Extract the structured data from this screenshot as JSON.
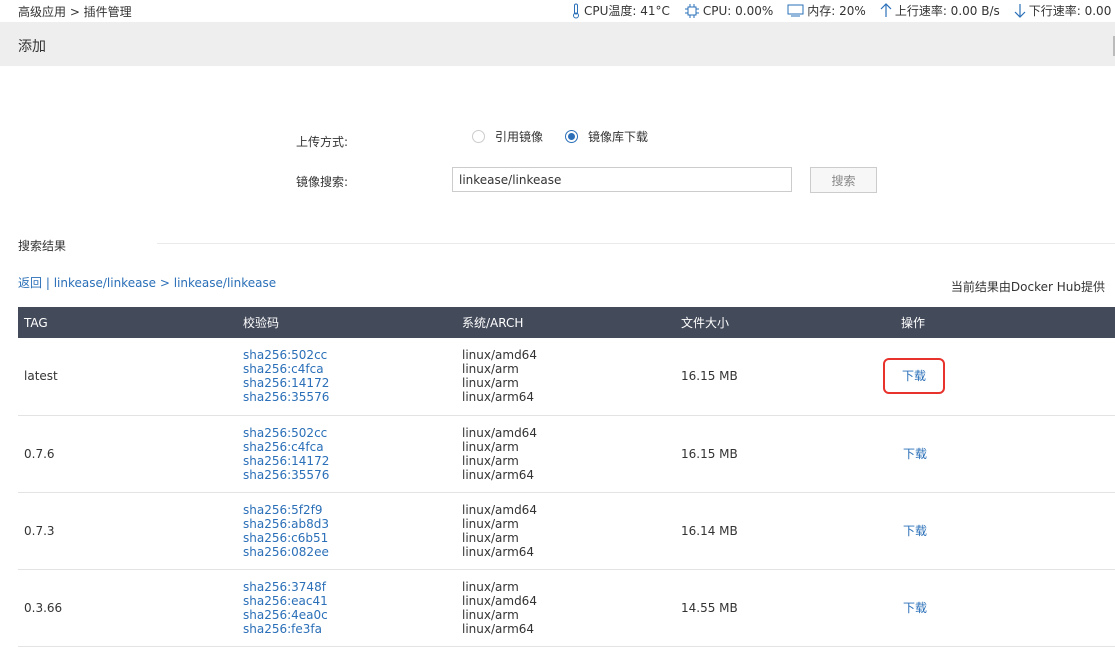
{
  "breadcrumb": "高级应用 > 插件管理",
  "status": {
    "cpu_temp": "CPU温度: 41°C",
    "cpu": "CPU: 0.00%",
    "memory": "内存: 20%",
    "upload": "上行速率: 0.00 B/s",
    "download": "下行速率: 0.00 B"
  },
  "header": {
    "title": "添加"
  },
  "form": {
    "upload_label": "上传方式:",
    "radio_ref": "引用镜像",
    "radio_repo": "镜像库下载",
    "selected": "镜像库下载",
    "search_label": "镜像搜索:",
    "search_value": "linkease/linkease",
    "search_button": "搜索"
  },
  "results": {
    "title": "搜索结果",
    "crumbs": {
      "back": "返回",
      "sep": " | ",
      "repo": "linkease/linkease",
      "arrow": " > ",
      "repo2": "linkease/linkease"
    },
    "provider": "当前结果由Docker Hub提供",
    "columns": [
      "TAG",
      "校验码",
      "系统/ARCH",
      "文件大小",
      "操作"
    ],
    "rows": [
      {
        "tag": "latest",
        "sha": [
          "sha256:502cc",
          "sha256:c4fca",
          "sha256:14172",
          "sha256:35576"
        ],
        "arch": [
          "linux/amd64",
          "linux/arm",
          "linux/arm",
          "linux/arm64"
        ],
        "size": "16.15 MB",
        "action": "下载"
      },
      {
        "tag": "0.7.6",
        "sha": [
          "sha256:502cc",
          "sha256:c4fca",
          "sha256:14172",
          "sha256:35576"
        ],
        "arch": [
          "linux/amd64",
          "linux/arm",
          "linux/arm",
          "linux/arm64"
        ],
        "size": "16.15 MB",
        "action": "下载"
      },
      {
        "tag": "0.7.3",
        "sha": [
          "sha256:5f2f9",
          "sha256:ab8d3",
          "sha256:c6b51",
          "sha256:082ee"
        ],
        "arch": [
          "linux/amd64",
          "linux/arm",
          "linux/arm",
          "linux/arm64"
        ],
        "size": "16.14 MB",
        "action": "下载"
      },
      {
        "tag": "0.3.66",
        "sha": [
          "sha256:3748f",
          "sha256:eac41",
          "sha256:4ea0c",
          "sha256:fe3fa"
        ],
        "arch": [
          "linux/arm",
          "linux/amd64",
          "linux/arm",
          "linux/arm64"
        ],
        "size": "14.55 MB",
        "action": "下载"
      }
    ]
  },
  "colors": {
    "accent": "#2a6fb8",
    "table_header": "#434a5a",
    "highlight": "#e8332d"
  },
  "icons": [
    "thermometer-icon",
    "cpu-chip-icon",
    "monitor-icon",
    "arrow-up-icon",
    "arrow-down-icon"
  ]
}
